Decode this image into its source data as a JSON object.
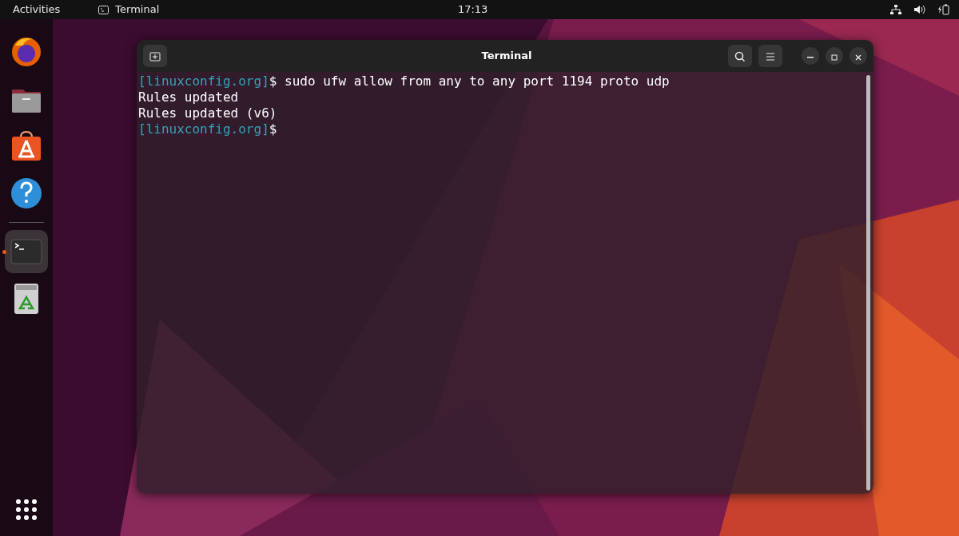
{
  "top_bar": {
    "activities": "Activities",
    "app_menu": "Terminal",
    "clock": "17:13"
  },
  "dock": {
    "groups": [
      [
        {
          "kind": "browser",
          "running": false
        },
        {
          "kind": "files",
          "running": false
        },
        {
          "kind": "store",
          "running": false
        },
        {
          "kind": "help",
          "running": false
        }
      ],
      [
        {
          "kind": "terminal",
          "running": true
        },
        {
          "kind": "trash",
          "running": false
        }
      ]
    ]
  },
  "window": {
    "title": "Terminal"
  },
  "terminal_lines": [
    {
      "kind": "prompt",
      "prompt": "[linuxconfig.org]",
      "text": "$ sudo ufw allow from any to any port 1194 proto udp"
    },
    {
      "kind": "output",
      "text": "Rules updated"
    },
    {
      "kind": "output",
      "text": "Rules updated (v6)"
    },
    {
      "kind": "prompt",
      "prompt": "[linuxconfig.org]",
      "text": "$"
    }
  ]
}
